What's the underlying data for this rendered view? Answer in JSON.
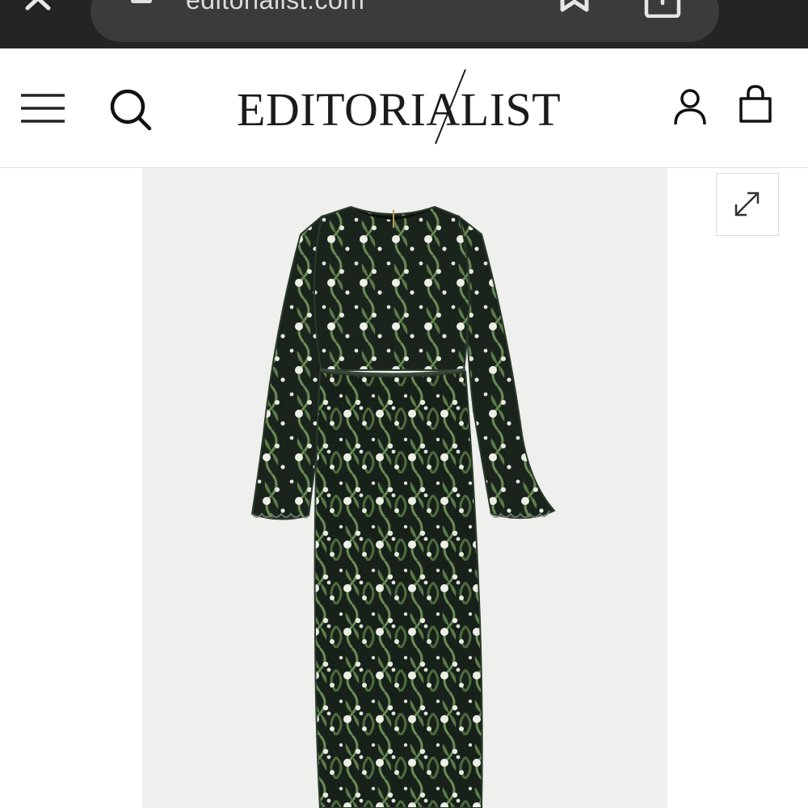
{
  "browser": {
    "url": "editorialist.com",
    "close_icon": "close-icon",
    "lock_icon": "lock-icon",
    "bookmark_icon": "bookmark-icon",
    "tabs_icon": "tabs-icon",
    "bar_color": "#242424"
  },
  "header": {
    "menu_icon": "hamburger-menu-icon",
    "search_icon": "search-icon",
    "logo_text": "EDITORIALIST",
    "account_icon": "user-icon",
    "bag_icon": "shopping-bag-icon"
  },
  "product": {
    "image_description_icon": "dress-image",
    "expand_icon": "expand-icon",
    "dress_colors": {
      "base": "#17211a",
      "leaf": "#5b7a48",
      "flower": "#ecefe6",
      "background": "#efefed"
    }
  }
}
